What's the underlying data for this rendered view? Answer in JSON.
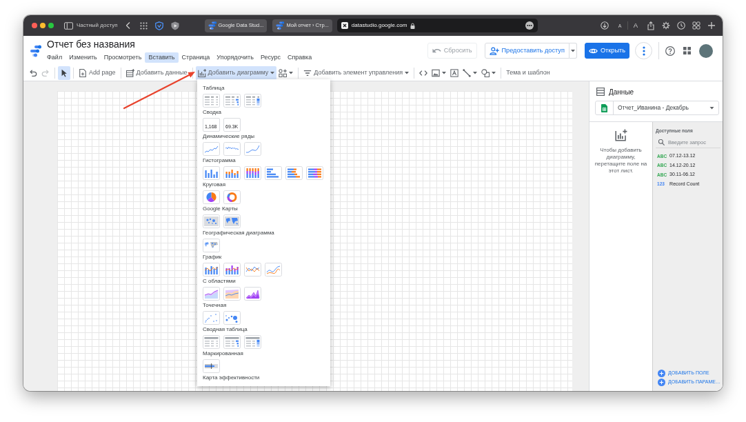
{
  "browser": {
    "private_label": "Частный доступ",
    "tabs": [
      {
        "title": "Google Data Stud...",
        "selected": false
      },
      {
        "title": "Мой отчет › Стр...",
        "selected": false
      },
      {
        "title": "datastudio.google.com",
        "selected": true
      }
    ],
    "text_size_buttons": [
      "A",
      "A"
    ]
  },
  "report": {
    "title": "Отчет без названия"
  },
  "menu": [
    {
      "label": "Файл",
      "selected": false
    },
    {
      "label": "Изменить",
      "selected": false
    },
    {
      "label": "Просмотреть",
      "selected": false
    },
    {
      "label": "Вставить",
      "selected": true
    },
    {
      "label": "Страница",
      "selected": false
    },
    {
      "label": "Упорядочить",
      "selected": false
    },
    {
      "label": "Ресурс",
      "selected": false
    },
    {
      "label": "Справка",
      "selected": false
    }
  ],
  "header_buttons": [
    {
      "kind": "reset",
      "label": "Сбросить",
      "disabled": true
    },
    {
      "kind": "share",
      "label": "Предоставить доступ",
      "disabled": false
    },
    {
      "kind": "view",
      "label": "Открыть",
      "disabled": false
    }
  ],
  "toolbar": {
    "groups": [
      [
        {
          "kind": "undo",
          "selected": false,
          "disabled": false
        },
        {
          "kind": "redo",
          "selected": false,
          "disabled": true
        }
      ],
      [
        {
          "kind": "select",
          "selected": true,
          "disabled": false
        }
      ],
      [
        {
          "kind": "add_page",
          "label": "Add page",
          "selected": false,
          "disabled": false
        }
      ],
      [
        {
          "kind": "add_data",
          "label": "Добавить данные",
          "selected": false,
          "disabled": false
        }
      ],
      [
        {
          "kind": "add_chart",
          "label": "Добавить диаграмму",
          "selected": true,
          "disabled": false
        },
        {
          "kind": "add_component",
          "selected": false,
          "disabled": false
        }
      ],
      [
        {
          "kind": "add_control",
          "label": "Добавить элемент управления",
          "selected": false,
          "disabled": false
        }
      ],
      [
        {
          "kind": "embed",
          "selected": false,
          "disabled": false
        },
        {
          "kind": "image",
          "selected": false,
          "disabled": false
        },
        {
          "kind": "text",
          "selected": false,
          "disabled": false
        },
        {
          "kind": "line",
          "selected": false,
          "disabled": false
        },
        {
          "kind": "shape",
          "selected": false,
          "disabled": false
        }
      ],
      [
        {
          "kind": "theme",
          "label": "Тема и шаблон",
          "selected": false,
          "disabled": false
        }
      ]
    ]
  },
  "chart_menu": {
    "sections": [
      {
        "label": "Таблица",
        "options": [
          {
            "kind": "table"
          },
          {
            "kind": "table_bars"
          },
          {
            "kind": "table_heatmap"
          }
        ]
      },
      {
        "label": "Сводка",
        "options": [
          {
            "kind": "scorecard",
            "value": "1,168"
          },
          {
            "kind": "scorecard",
            "value": "69.3K"
          }
        ]
      },
      {
        "label": "Динамические ряды",
        "options": [
          {
            "kind": "timeseries"
          },
          {
            "kind": "sparkline"
          },
          {
            "kind": "smoothed_timeseries"
          }
        ]
      },
      {
        "label": "Гистограмма",
        "options": [
          {
            "kind": "column"
          },
          {
            "kind": "stacked_column"
          },
          {
            "kind": "stacked_column_100"
          },
          {
            "kind": "bar"
          },
          {
            "kind": "stacked_bar"
          },
          {
            "kind": "stacked_bar_100"
          }
        ]
      },
      {
        "label": "Круговая",
        "options": [
          {
            "kind": "pie"
          },
          {
            "kind": "donut"
          }
        ]
      },
      {
        "label": "Google Карты",
        "options": [
          {
            "kind": "bubble_map"
          },
          {
            "kind": "filled_map"
          }
        ]
      },
      {
        "label": "Географическая диаграмма",
        "options": [
          {
            "kind": "geo"
          }
        ]
      },
      {
        "label": "График",
        "options": [
          {
            "kind": "combo"
          },
          {
            "kind": "stacked_combo"
          },
          {
            "kind": "line"
          },
          {
            "kind": "smoothed_line"
          }
        ]
      },
      {
        "label": "С областями",
        "options": [
          {
            "kind": "area"
          },
          {
            "kind": "stacked_area"
          },
          {
            "kind": "stacked_area_100"
          }
        ]
      },
      {
        "label": "Точечная",
        "options": [
          {
            "kind": "scatter"
          },
          {
            "kind": "bubble"
          }
        ]
      },
      {
        "label": "Сводная таблица",
        "options": [
          {
            "kind": "pivot"
          },
          {
            "kind": "pivot_bars"
          },
          {
            "kind": "pivot_heatmap"
          }
        ]
      },
      {
        "label": "Маркированная",
        "options": [
          {
            "kind": "bullet"
          }
        ]
      },
      {
        "label": "Карта эффективности"
      }
    ]
  },
  "data_panel": {
    "title": "Данные",
    "source": "Отчет_Иванина - Декабрь",
    "empty_hint": "Чтобы добавить диаграмму, перетащите поле на этот лист.",
    "fields_title": "Доступные поля",
    "search": {
      "placeholder": "Введите запрос"
    },
    "fields": [
      {
        "kind": "text",
        "type_label": "ABC",
        "name": "07.12-13.12"
      },
      {
        "kind": "text",
        "type_label": "ABC",
        "name": "14.12-20.12"
      },
      {
        "kind": "text",
        "type_label": "ABC",
        "name": "30.11-06.12"
      },
      {
        "kind": "number",
        "type_label": "123",
        "name": "Record Count"
      }
    ],
    "actions": [
      "ДОБАВИТЬ ПОЛЕ",
      "ДОБАВИТЬ ПАРАМЕ…"
    ]
  }
}
